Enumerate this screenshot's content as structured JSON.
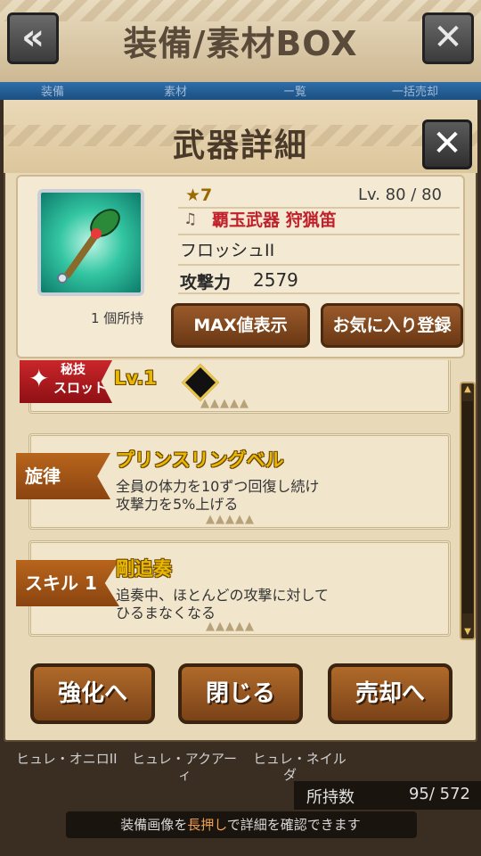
{
  "topbar": {
    "title": "装備/素材BOX",
    "back_icon": "«",
    "close_icon": "✕",
    "tabs": [
      "装備",
      "素材",
      "ー覧",
      "一括売却"
    ]
  },
  "dialog": {
    "title": "武器詳細",
    "close_icon": "✕",
    "weapon": {
      "rarity": "★7",
      "level": "Lv. 80 / 80",
      "category": "覇玉武器 狩猟笛",
      "name": "フロッシュII",
      "attack_label": "攻撃力",
      "attack_value": "2579",
      "owned": "1 個所持"
    },
    "buttons": {
      "max": "MAX値表示",
      "favorite": "お気に入り登録"
    },
    "skills": {
      "secret_slot": {
        "badge_line1": "秘技",
        "badge_line2": "スロット",
        "level": "Lv.1"
      },
      "melody": {
        "tag": "旋律",
        "title": "プリンスリングベル",
        "desc1": "全員の体力を10ずつ回復し続け",
        "desc2": "攻撃力を5%上げる"
      },
      "skill1": {
        "tag": "スキル 1",
        "title": "剛追奏",
        "desc1": "追奏中、ほとんどの攻撃に対して",
        "desc2": "ひるまなくなる"
      }
    },
    "actions": {
      "enhance": "強化へ",
      "close": "閉じる",
      "sell": "売却へ"
    }
  },
  "background": {
    "names": [
      "ヒュレ・オニロII",
      "ヒュレ・アクアー",
      "ヒュレ・ネイル",
      "ィ",
      "ダ"
    ],
    "count_label": "所持数",
    "count_value": "95/ 572",
    "hint_pre": "装備画像を",
    "hint_hl": "長押し",
    "hint_post": "で詳細を確認できます"
  },
  "colors": {
    "accent_red": "#c0202a",
    "title_gold": "#e8b800",
    "rarity_gold": "#9a6a00"
  }
}
